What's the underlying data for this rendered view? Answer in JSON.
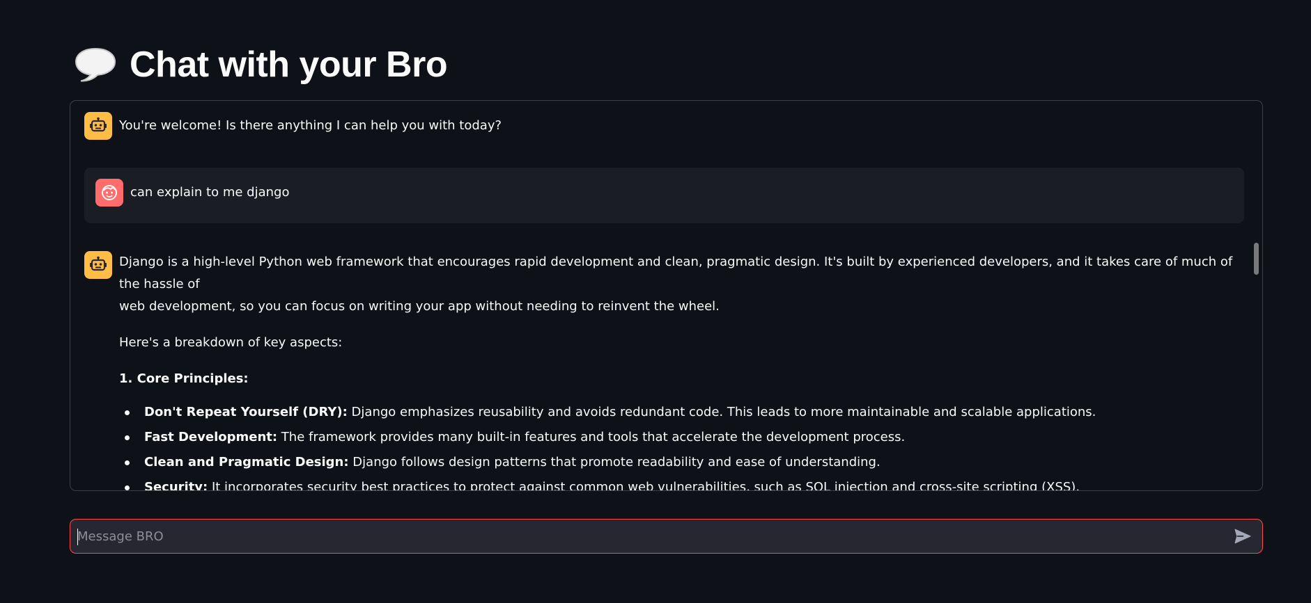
{
  "header": {
    "title": "Chat with your Bro",
    "icon": "speech-balloon-icon"
  },
  "messages": [
    {
      "role": "assistant",
      "avatar_icon": "robot-face-icon",
      "text": "You're welcome! Is there anything I can help you with today?"
    },
    {
      "role": "user",
      "avatar_icon": "smiling-face-icon",
      "text": "can explain to me django"
    },
    {
      "role": "assistant",
      "avatar_icon": "robot-face-icon",
      "intro_line1": "Django is a high-level Python web framework that encourages rapid development and clean, pragmatic design. It's built by experienced developers, and it takes care of much of the hassle of",
      "intro_line2": "web development, so you can focus on writing your app without needing to reinvent the wheel.",
      "breakdown": "Here's a breakdown of key aspects:",
      "section_heading": "1. Core Principles:",
      "bullets": [
        {
          "term": "Don't Repeat Yourself (DRY):",
          "desc": " Django emphasizes reusability and avoids redundant code. This leads to more maintainable and scalable applications."
        },
        {
          "term": "Fast Development:",
          "desc": " The framework provides many built-in features and tools that accelerate the development process."
        },
        {
          "term": "Clean and Pragmatic Design:",
          "desc": " Django follows design patterns that promote readability and ease of understanding."
        },
        {
          "term": "Security:",
          "desc": " It incorporates security best practices to protect against common web vulnerabilities, such as SQL injection and cross-site scripting (XSS)."
        }
      ]
    }
  ],
  "input": {
    "placeholder": "Message BRO",
    "value": ""
  },
  "send_button": {
    "icon": "send-icon"
  },
  "colors": {
    "background": "#0e1117",
    "assistant_avatar": "#ffbd45",
    "user_avatar": "#ff6c6c",
    "user_bubble": "#1a1d24",
    "input_border": "#ff4b4b",
    "input_bg": "#262730"
  }
}
